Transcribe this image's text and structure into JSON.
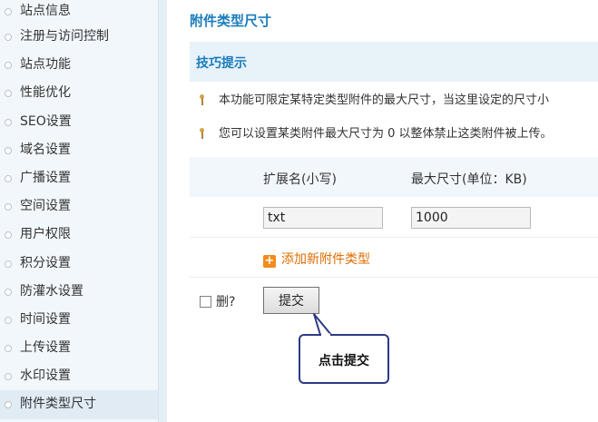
{
  "sidebar": {
    "items": [
      {
        "label": "站点信息"
      },
      {
        "label": "注册与访问控制"
      },
      {
        "label": "站点功能"
      },
      {
        "label": "性能优化"
      },
      {
        "label": "SEO设置"
      },
      {
        "label": "域名设置"
      },
      {
        "label": "广播设置"
      },
      {
        "label": "空间设置"
      },
      {
        "label": "用户权限"
      },
      {
        "label": "积分设置"
      },
      {
        "label": "防灌水设置"
      },
      {
        "label": "时间设置"
      },
      {
        "label": "上传设置"
      },
      {
        "label": "水印设置"
      },
      {
        "label": "附件类型尺寸",
        "active": true
      }
    ]
  },
  "main": {
    "title": "附件类型尺寸",
    "tips": {
      "title": "技巧提示",
      "items": [
        "本功能可限定某特定类型附件的最大尺寸，当这里设定的尺寸小",
        "您可以设置某类附件最大尺寸为  0 以整体禁止这类附件被上传。"
      ]
    },
    "table": {
      "col_ext": "扩展名(小写)",
      "col_size": "最大尺寸(单位：KB)",
      "rows": [
        {
          "ext": "txt",
          "size": "1000"
        }
      ]
    },
    "add_link": "添加新附件类型",
    "add_icon": "+",
    "delete_label": "删?",
    "submit_label": "提交"
  },
  "callout": {
    "text": "点击提交"
  },
  "colors": {
    "accent": "#1a7dbb",
    "link_orange": "#e06c00",
    "callout_border": "#2d3a86"
  }
}
